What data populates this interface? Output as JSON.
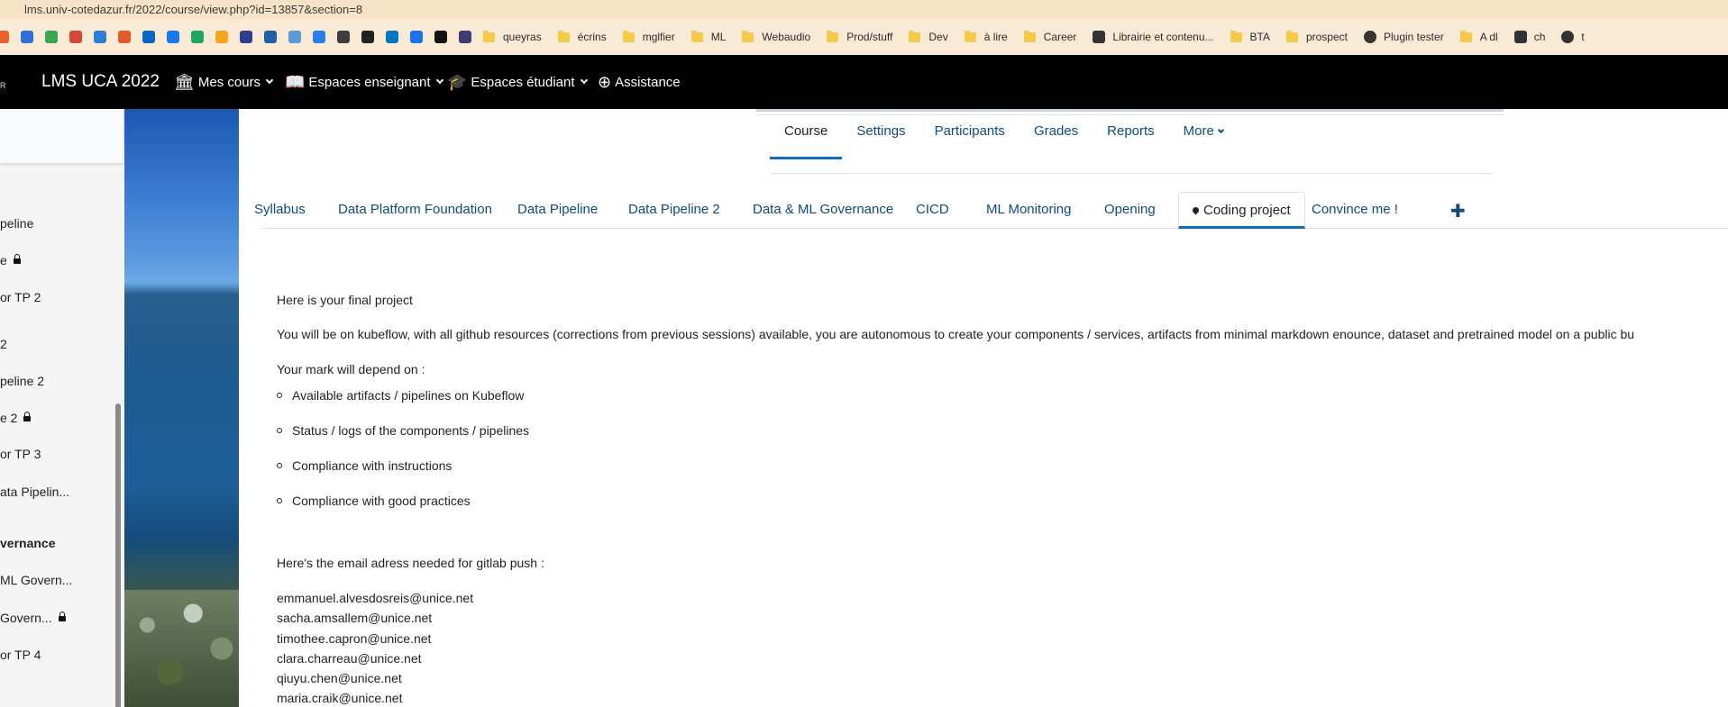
{
  "browser": {
    "url": "lms.univ-cotedazur.fr/2022/course/view.php?id=13857&section=8",
    "bookmark_icons": [
      {
        "name": "bookmark-icon-1",
        "color": "#e8622c"
      },
      {
        "name": "bookmark-icon-2",
        "color": "#2f6fd6"
      },
      {
        "name": "bookmark-icon-3",
        "color": "#3aa757"
      },
      {
        "name": "bookmark-icon-4",
        "color": "#d44638"
      },
      {
        "name": "bookmark-icon-5",
        "color": "#2d7fd3"
      },
      {
        "name": "bookmark-icon-6",
        "color": "#e15a2a"
      },
      {
        "name": "bookmark-icon-7",
        "color": "#0a66c2"
      },
      {
        "name": "bookmark-icon-8",
        "color": "#1877f2"
      },
      {
        "name": "bookmark-icon-9",
        "color": "#1fa463"
      },
      {
        "name": "bookmark-icon-10",
        "color": "#f4a71d"
      },
      {
        "name": "bookmark-icon-11",
        "color": "#2f3c8f"
      },
      {
        "name": "bookmark-icon-12",
        "color": "#1f5fa8"
      },
      {
        "name": "bookmark-icon-13",
        "color": "#5b9bd5"
      },
      {
        "name": "bookmark-icon-14",
        "color": "#2b7de9"
      },
      {
        "name": "bookmark-icon-15",
        "color": "#3d3d3d"
      },
      {
        "name": "bookmark-icon-16",
        "color": "#222222"
      },
      {
        "name": "bookmark-icon-17",
        "color": "#0079bf"
      },
      {
        "name": "bookmark-icon-18",
        "color": "#1a73e8"
      },
      {
        "name": "bookmark-icon-19",
        "color": "#111111"
      },
      {
        "name": "bookmark-icon-20",
        "color": "#3c3c6e"
      }
    ],
    "bookmarks": [
      {
        "label": "queyras",
        "type": "folder"
      },
      {
        "label": "écrins",
        "type": "folder"
      },
      {
        "label": "mglfier",
        "type": "folder"
      },
      {
        "label": "ML",
        "type": "folder"
      },
      {
        "label": "Webaudio",
        "type": "folder"
      },
      {
        "label": "Prod/stuff",
        "type": "folder"
      },
      {
        "label": "Dev",
        "type": "folder"
      },
      {
        "label": "à lire",
        "type": "folder"
      },
      {
        "label": "Career",
        "type": "folder"
      },
      {
        "label": "Librairie et contenu...",
        "type": "site"
      },
      {
        "label": "BTA",
        "type": "folder"
      },
      {
        "label": "prospect",
        "type": "folder"
      },
      {
        "label": "Plugin tester",
        "type": "globe"
      },
      {
        "label": "A dl",
        "type": "folder"
      },
      {
        "label": "ch",
        "type": "site"
      }
    ],
    "trailing_bookmark": "t"
  },
  "navbar": {
    "logo_fragment": "R",
    "brand": "LMS UCA 2022",
    "items": [
      {
        "label": "Mes cours",
        "icon": "bank-icon"
      },
      {
        "label": "Espaces enseignant",
        "icon": "book-icon"
      },
      {
        "label": "Espaces étudiant",
        "icon": "graduation-cap-icon"
      },
      {
        "label": "Assistance",
        "icon": "lifebuoy-icon"
      }
    ]
  },
  "drawer": {
    "items": [
      {
        "label": "peline",
        "locked": false,
        "bold": false
      },
      {
        "label": "e",
        "locked": true,
        "bold": false
      },
      {
        "label": "or TP 2",
        "locked": false,
        "bold": false
      },
      {
        "label": "2",
        "locked": false,
        "bold": false
      },
      {
        "label": "peline 2",
        "locked": false,
        "bold": false
      },
      {
        "label": "e 2",
        "locked": true,
        "bold": false
      },
      {
        "label": "or TP 3",
        "locked": false,
        "bold": false
      },
      {
        "label": "ata Pipelin...",
        "locked": false,
        "bold": false
      },
      {
        "label": "vernance",
        "locked": false,
        "bold": true
      },
      {
        "label": "ML Govern...",
        "locked": false,
        "bold": false
      },
      {
        "label": "Govern...",
        "locked": true,
        "bold": false
      },
      {
        "label": "or TP 4",
        "locked": false,
        "bold": false
      }
    ]
  },
  "secondary_nav": {
    "tabs": [
      "Course",
      "Settings",
      "Participants",
      "Grades",
      "Reports",
      "More"
    ],
    "active": "Course"
  },
  "topics": {
    "tabs": [
      "Syllabus",
      "Data Platform Foundation",
      "Data Pipeline",
      "Data Pipeline 2",
      "Data & ML Governance",
      "CICD",
      "ML Monitoring",
      "Opening",
      "Coding project",
      "Convince me !"
    ],
    "active": "Coding project",
    "add_symbol": "✚"
  },
  "content": {
    "intro": "Here is your final project",
    "description": "You will be on kubeflow, with all github resources (corrections from previous sessions) available, you are autonomous to create your components / services, artifacts from minimal markdown enounce, dataset and pretrained model on a public bu",
    "mark_heading": "Your mark will depend on :",
    "criteria": [
      "Available artifacts / pipelines on Kubeflow",
      "Status / logs of the components / pipelines",
      "Compliance with instructions",
      "Compliance with good practices"
    ],
    "email_heading": "Here's the email adress needed for gitlab push :",
    "emails": [
      "emmanuel.alvesdosreis@unice.net",
      "sacha.amsallem@unice.net",
      "timothee.capron@unice.net",
      "clara.charreau@unice.net",
      "qiuyu.chen@unice.net",
      "maria.craik@unice.net"
    ]
  }
}
